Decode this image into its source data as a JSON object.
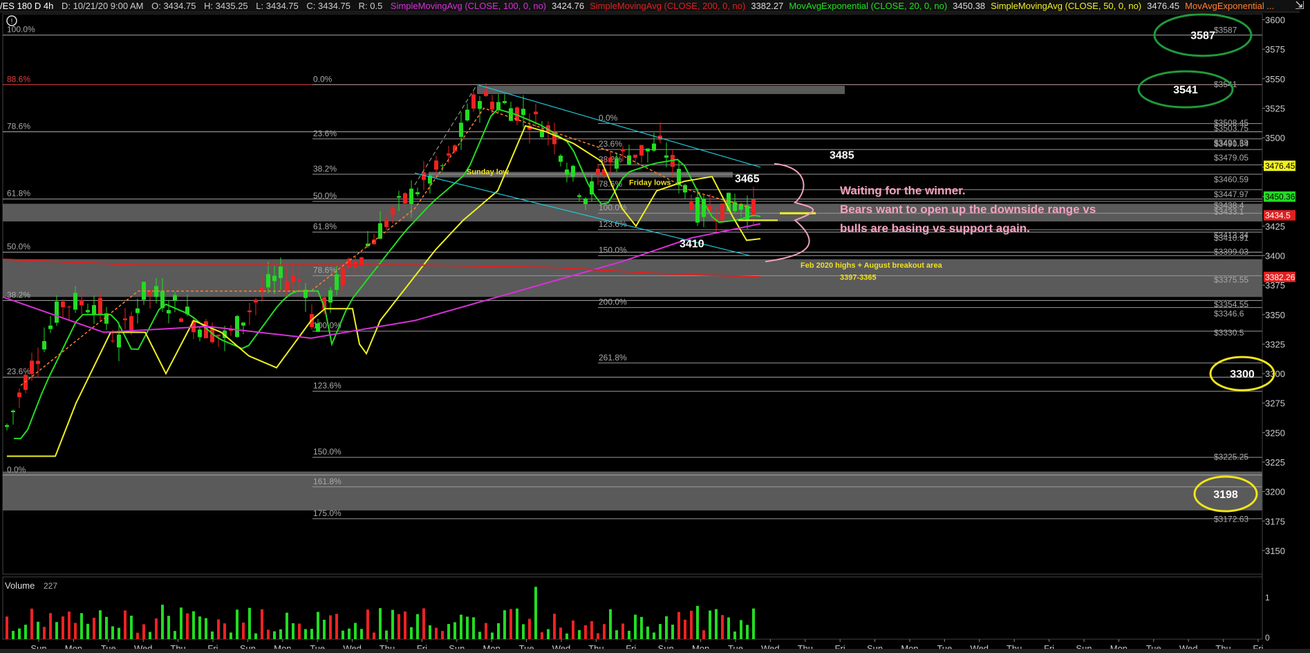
{
  "header": {
    "symbol": "/ES 180 D 4h",
    "date": "D: 10/21/20 9:00 AM",
    "open": "O: 3434.75",
    "high": "H: 3435.25",
    "low": "L: 3434.75",
    "close": "C: 3434.75",
    "range": "R: 0.5",
    "studies": [
      {
        "label": "SimpleMovingAvg (CLOSE, 100, 0, no)",
        "value": "3424.76",
        "color": "#d930d9"
      },
      {
        "label": "SimpleMovingAvg (CLOSE, 200, 0, no)",
        "value": "3382.27",
        "color": "#e02020"
      },
      {
        "label": "MovAvgExponential (CLOSE, 20, 0, no)",
        "value": "3450.38",
        "color": "#22e022"
      },
      {
        "label": "SimpleMovingAvg (CLOSE, 50, 0, no)",
        "value": "3476.45",
        "color": "#f0f020"
      },
      {
        "label": "MovAvgExponential ...",
        "value": "",
        "color": "#ff8030"
      }
    ]
  },
  "chart_data": {
    "type": "candlestick",
    "symbol": "/ES",
    "timeframe": "180 D 4h",
    "ylim": [
      3130,
      3605
    ],
    "y_ticks": [
      3150,
      3175,
      3200,
      3225,
      3250,
      3275,
      3300,
      3325,
      3350,
      3375,
      3400,
      3425,
      3450,
      3475,
      3500,
      3525,
      3550,
      3575,
      3600
    ],
    "x_labels": [
      "Sun",
      "Mon",
      "Tue",
      "Wed",
      "Thu",
      "Fri",
      "Sun",
      "Mon",
      "Tue",
      "Wed",
      "Thu",
      "Fri",
      "Sun",
      "Mon",
      "Tue",
      "Wed",
      "Thu",
      "Fri",
      "Sun",
      "Mon",
      "Tue",
      "Wed",
      "Thu",
      "Fri",
      "Sun",
      "Mon",
      "Tue",
      "Wed",
      "Thu",
      "Fri",
      "Sun",
      "Mon",
      "Tue",
      "Wed",
      "Thu",
      "Fri"
    ],
    "left_fib": [
      {
        "label": "100.0%",
        "value": 3587
      },
      {
        "label": "88.6%",
        "value": 3545,
        "color": "#e04040"
      },
      {
        "label": "78.6%",
        "value": 3505
      },
      {
        "label": "61.8%",
        "value": 3448
      },
      {
        "label": "50.0%",
        "value": 3403
      },
      {
        "label": "38.2%",
        "value": 3362
      },
      {
        "label": "23.6%",
        "value": 3297
      },
      {
        "label": "0.0%",
        "value": 3214
      }
    ],
    "mid_fib": [
      {
        "label": "0.0%",
        "value": 3545
      },
      {
        "label": "23.6%",
        "value": 3499
      },
      {
        "label": "38.2%",
        "value": 3469
      },
      {
        "label": "50.0%",
        "value": 3446
      },
      {
        "label": "61.8%",
        "value": 3420
      },
      {
        "label": "78.6%",
        "value": 3383
      },
      {
        "label": "100.0%",
        "value": 3336
      },
      {
        "label": "123.6%",
        "value": 3285
      },
      {
        "label": "150.0%",
        "value": 3229
      },
      {
        "label": "161.8%",
        "value": 3204
      },
      {
        "label": "175.0%",
        "value": 3177
      }
    ],
    "right_fib": [
      {
        "label": "0.0%",
        "value": 3512
      },
      {
        "label": "23.6%",
        "value": 3490
      },
      {
        "label": "38.2%",
        "value": 3477
      },
      {
        "label": "78.6%",
        "value": 3456
      },
      {
        "label": "100.0%",
        "value": 3436
      },
      {
        "label": "123.6%",
        "value": 3422
      },
      {
        "label": "150.0%",
        "value": 3400
      },
      {
        "label": "200.0%",
        "value": 3356
      },
      {
        "label": "261.8%",
        "value": 3309
      }
    ],
    "price_levels": [
      {
        "label": "$3587",
        "value": 3587
      },
      {
        "label": "$3541",
        "value": 3541
      },
      {
        "label": "$3508.45",
        "value": 3508.45
      },
      {
        "label": "$3503.75",
        "value": 3503.75
      },
      {
        "label": "$3491.39",
        "value": 3491.39
      },
      {
        "label": "$3490.54",
        "value": 3490.54
      },
      {
        "label": "$3479.05",
        "value": 3479.05
      },
      {
        "label": "$3460.59",
        "value": 3460.59
      },
      {
        "label": "$3447.97",
        "value": 3447.97
      },
      {
        "label": "$3438.4",
        "value": 3438.4
      },
      {
        "label": "$3433.1",
        "value": 3433.1
      },
      {
        "label": "$3413.34",
        "value": 3413.34
      },
      {
        "label": "$3410.91",
        "value": 3410.91
      },
      {
        "label": "$3399.03",
        "value": 3399.03
      },
      {
        "label": "$3375.55",
        "value": 3375.55
      },
      {
        "label": "$3354.55",
        "value": 3354.55
      },
      {
        "label": "$3346.6",
        "value": 3346.6
      },
      {
        "label": "$3330.5",
        "value": 3330.5
      },
      {
        "label": "$3225.25",
        "value": 3225.25
      },
      {
        "label": "$3172.63",
        "value": 3172.63
      }
    ],
    "markers": [
      {
        "label": "3476.45",
        "value": 3476.45,
        "bg": "#f0f020",
        "fg": "#000"
      },
      {
        "label": "3450.36",
        "value": 3450.36,
        "bg": "#22dd22",
        "fg": "#000"
      },
      {
        "label": "3434.5",
        "value": 3434.5,
        "bg": "#e02020",
        "fg": "#fff"
      },
      {
        "label": "3382.26",
        "value": 3382.26,
        "bg": "#e02020",
        "fg": "#fff"
      }
    ],
    "annotations": {
      "a3485": "3485",
      "a3465": "3465",
      "a3410": "3410",
      "sunday_low": "Sunday low",
      "friday_lows": "Friday lows",
      "waiting": "Waiting for the winner.",
      "bears": "Bears want to open up the downside range vs",
      "bulls": "bulls are basing vs support again.",
      "feb_area": "Feb 2020 highs + August breakout area",
      "feb_range": "3397-3365"
    },
    "circles": [
      {
        "label": "3587",
        "value": 3587,
        "color": "#1f9a3a"
      },
      {
        "label": "3541",
        "value": 3541,
        "color": "#1f9a3a"
      },
      {
        "label": "3300",
        "value": 3300,
        "color": "#f2e51a"
      },
      {
        "label": "3198",
        "value": 3198,
        "color": "#f2e51a"
      }
    ],
    "gray_zones": [
      {
        "top": 3544,
        "bottom": 3537
      },
      {
        "top": 3444,
        "bottom": 3429
      },
      {
        "top": 3397,
        "bottom": 3365
      },
      {
        "top": 3217,
        "bottom": 3184
      }
    ],
    "volume": {
      "label": "Volume",
      "value": "227",
      "ticks": [
        "1",
        "0"
      ]
    }
  }
}
